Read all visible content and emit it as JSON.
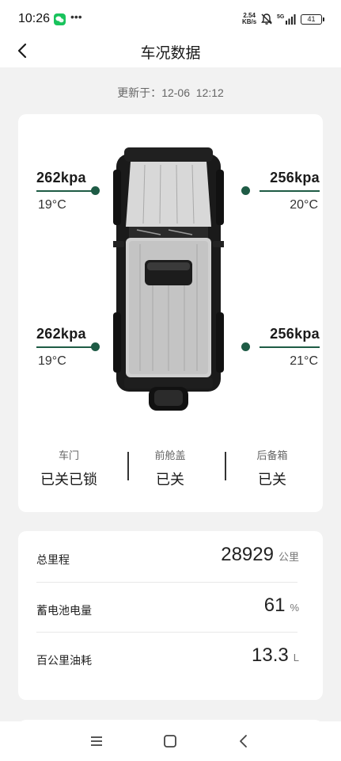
{
  "status_bar": {
    "time": "10:26",
    "network_speed_value": "2.54",
    "network_speed_unit": "KB/s",
    "network_type": "5G",
    "battery": "41",
    "icons": [
      "wechat-icon",
      "more-dots-icon",
      "mute-icon",
      "signal-icon",
      "battery-icon"
    ]
  },
  "header": {
    "back_icon": "chevron-left-icon",
    "title": "车况数据"
  },
  "update": {
    "label": "更新于：",
    "time": "12-06  12:12"
  },
  "tires": {
    "front_left": {
      "pressure": "262kpa",
      "temperature": "19°C"
    },
    "front_right": {
      "pressure": "256kpa",
      "temperature": "20°C"
    },
    "rear_left": {
      "pressure": "262kpa",
      "temperature": "19°C"
    },
    "rear_right": {
      "pressure": "256kpa",
      "temperature": "21°C"
    }
  },
  "closures": [
    {
      "label": "车门",
      "value": "已关已锁"
    },
    {
      "label": "前舱盖",
      "value": "已关"
    },
    {
      "label": "后备箱",
      "value": "已关"
    }
  ],
  "stats": [
    {
      "label": "总里程",
      "value": "28929",
      "unit": "公里"
    },
    {
      "label": "蓄电池电量",
      "value": "61",
      "unit": "%"
    },
    {
      "label": "百公里油耗",
      "value": "13.3",
      "unit": "L"
    }
  ],
  "nav": {
    "icons": [
      "menu-icon",
      "home-icon",
      "back-icon"
    ]
  },
  "colors": {
    "accent": "#1e5b45",
    "background": "#f2f2f2",
    "card": "#ffffff"
  }
}
